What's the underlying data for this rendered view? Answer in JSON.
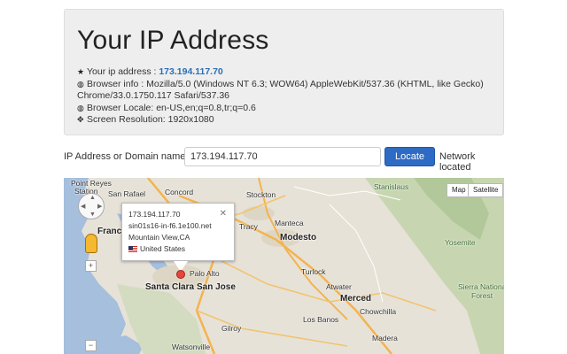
{
  "page": {
    "title": "Your IP Address"
  },
  "info": {
    "ip_label": "Your ip address : ",
    "ip_value": "173.194.117.70",
    "browser_info": "Browser info : Mozilla/5.0 (Windows NT 6.3; WOW64) AppleWebKit/537.36 (KHTML, like Gecko) Chrome/33.0.1750.117 Safari/537.36",
    "browser_locale": "Browser Locale: en-US,en;q=0.8,tr;q=0.6",
    "screen_resolution": "Screen Resolution: 1920x1080",
    "icons": [
      "star-icon",
      "globe-icon",
      "globe-icon",
      "expand-icon"
    ]
  },
  "form": {
    "label": "IP Address or Domain name :",
    "input_value": "173.194.117.70",
    "button_label": "Locate",
    "status": "Network located",
    "accent_color": "#2d6bc4"
  },
  "map": {
    "type_buttons": [
      "Map",
      "Satellite"
    ],
    "zoom_in": "+",
    "zoom_out": "−",
    "popup": {
      "ip": "173.194.117.70",
      "host": "sin01s16-in-f6.1e100.net",
      "location": "Mountain View,CA",
      "country": "United States",
      "close": "✕"
    },
    "labels": {
      "point_reyes": "Point Reyes",
      "station": "Station",
      "san_rafael": "San Rafael",
      "concord": "Concord",
      "stockton": "Stockton",
      "francisco": "Franci",
      "tracy": "Tracy",
      "manteca": "Manteca",
      "modesto": "Modesto",
      "turlock": "Turlock",
      "palo_alto": "Palo Alto",
      "santa_clara": "Santa Clara",
      "san_jose": "San Jose",
      "gilroy": "Gilroy",
      "watsonville": "Watsonville",
      "los_banos": "Los Banos",
      "merced": "Merced",
      "chowchilla": "Chowchilla",
      "atwater": "Atwater",
      "madera": "Madera",
      "sierra_national": "Sierra National",
      "forest": "Forest",
      "yosemite": "Yosemite",
      "stanislaus": "Stanislaus"
    }
  }
}
